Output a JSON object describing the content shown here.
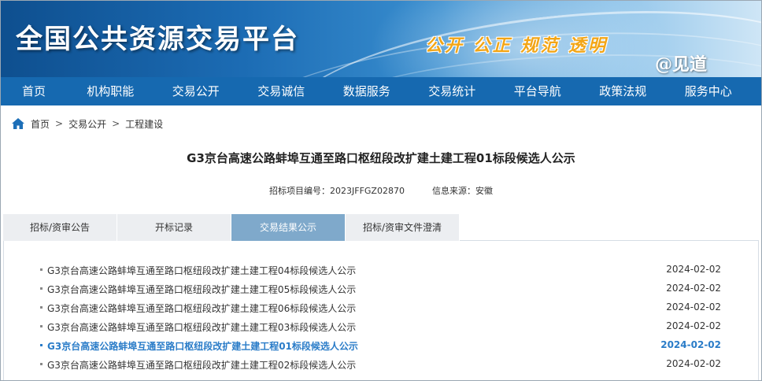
{
  "header": {
    "site_title": "全国公共资源交易平台",
    "slogan": "公开 公正 规范 透明",
    "watermark": "@见道"
  },
  "nav": {
    "items": [
      "首页",
      "机构职能",
      "交易公开",
      "交易诚信",
      "数据服务",
      "交易统计",
      "平台导航",
      "政策法规",
      "服务中心"
    ]
  },
  "breadcrumb": {
    "items": [
      "首页",
      "交易公开",
      "工程建设"
    ],
    "separator": ">"
  },
  "article": {
    "title": "G3京台高速公路蚌埠互通至路口枢纽段改扩建土建工程01标段候选人公示",
    "project_code_label": "招标项目编号：",
    "project_code": "2023JFFGZ02870",
    "source_label": "信息来源：",
    "source": "安徽"
  },
  "tabs": [
    {
      "label": "招标/资审公告",
      "active": false
    },
    {
      "label": "开标记录",
      "active": false
    },
    {
      "label": "交易结果公示",
      "active": true
    },
    {
      "label": "招标/资审文件澄清",
      "active": false
    }
  ],
  "list": [
    {
      "title": "G3京台高速公路蚌埠互通至路口枢纽段改扩建土建工程04标段候选人公示",
      "date": "2024-02-02",
      "current": false
    },
    {
      "title": "G3京台高速公路蚌埠互通至路口枢纽段改扩建土建工程05标段候选人公示",
      "date": "2024-02-02",
      "current": false
    },
    {
      "title": "G3京台高速公路蚌埠互通至路口枢纽段改扩建土建工程06标段候选人公示",
      "date": "2024-02-02",
      "current": false
    },
    {
      "title": "G3京台高速公路蚌埠互通至路口枢纽段改扩建土建工程03标段候选人公示",
      "date": "2024-02-02",
      "current": false
    },
    {
      "title": "G3京台高速公路蚌埠互通至路口枢纽段改扩建土建工程01标段候选人公示",
      "date": "2024-02-02",
      "current": true
    },
    {
      "title": "G3京台高速公路蚌埠互通至路口枢纽段改扩建土建工程02标段候选人公示",
      "date": "2024-02-02",
      "current": false
    }
  ],
  "colors": {
    "nav_bg": "#1669b0",
    "active_tab": "#7fa9cb",
    "current_link": "#2a7cc8",
    "slogan": "#f2a516"
  }
}
